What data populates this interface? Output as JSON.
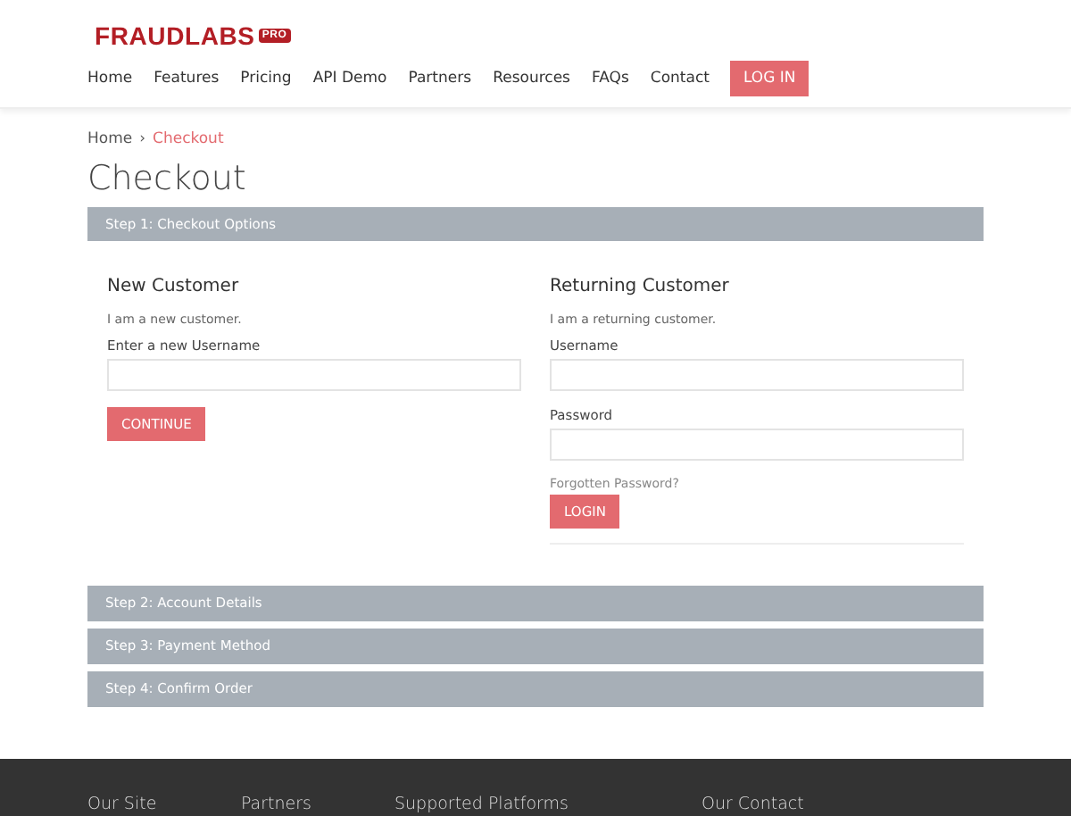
{
  "logo": {
    "name": "FRAUDLABS",
    "badge": "PRO"
  },
  "nav": [
    {
      "label": "Home",
      "kind": "link"
    },
    {
      "label": "Features",
      "kind": "link"
    },
    {
      "label": "Pricing",
      "kind": "link"
    },
    {
      "label": "API Demo",
      "kind": "link"
    },
    {
      "label": "Partners",
      "kind": "link"
    },
    {
      "label": "Resources",
      "kind": "link"
    },
    {
      "label": "FAQs",
      "kind": "link"
    },
    {
      "label": "Contact",
      "kind": "link"
    },
    {
      "label": "LOG IN",
      "kind": "button"
    }
  ],
  "breadcrumb": [
    {
      "label": "Home",
      "selected": false
    },
    {
      "label": "Checkout",
      "selected": true
    }
  ],
  "breadcrumb_separator": "›",
  "title": "Checkout",
  "steps": [
    {
      "label": "Step 1: Checkout Options",
      "expanded": true
    },
    {
      "label": "Step 2: Account Details",
      "expanded": false
    },
    {
      "label": "Step 3: Payment Method",
      "expanded": false
    },
    {
      "label": "Step 4: Confirm Order",
      "expanded": false
    }
  ],
  "new_customer": {
    "heading": "New Customer",
    "text": "I am a new customer.",
    "field_label": "Enter a new Username",
    "button": "CONTINUE"
  },
  "returning_customer": {
    "heading": "Returning Customer",
    "text": "I am a returning customer.",
    "username_label": "Username",
    "password_label": "Password",
    "forgot_link": "Forgotten Password?",
    "button": "LOGIN"
  },
  "footer": {
    "headings": [
      "Our Site",
      "Partners",
      "Supported Platforms",
      "Our Contact"
    ]
  }
}
